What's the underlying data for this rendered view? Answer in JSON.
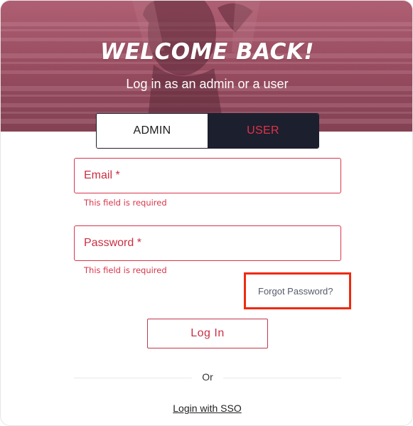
{
  "hero": {
    "title": "WELCOME BACK!",
    "subtitle": "Log in as an admin or a user"
  },
  "tabs": [
    {
      "label": "ADMIN",
      "active": false
    },
    {
      "label": "USER",
      "active": true
    }
  ],
  "form": {
    "email": {
      "label": "Email *",
      "error": "This field is required"
    },
    "password": {
      "label": "Password *",
      "error": "This field is required"
    },
    "forgot_label": "Forgot Password?",
    "login_label": "Log In",
    "divider_text": "Or",
    "sso_label": "Login with SSO"
  },
  "colors": {
    "accent": "#d8354a",
    "tab_active_bg": "#1c1f2e",
    "highlight": "#ee2a10"
  }
}
